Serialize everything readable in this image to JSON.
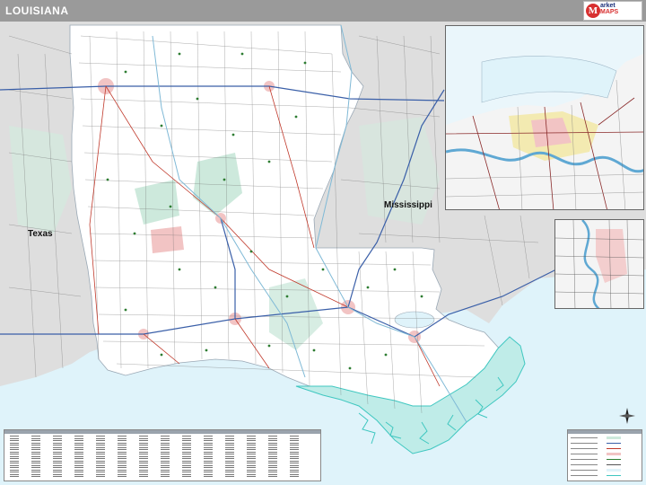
{
  "header": {
    "title": "LOUISIANA"
  },
  "map": {
    "labels": {
      "texas": "Texas",
      "mississippi": "Mississippi"
    },
    "colors": {
      "water": "#dff3fa",
      "coast_water": "#3fc7c0",
      "land_louisiana": "#ffffff",
      "land_neighbors": "#dedede",
      "urban": "#f2c4c4",
      "forest": "#cde9dc",
      "roads": "#555555",
      "interstate": "#3a5fa8",
      "highway": "#c0392b",
      "route_markers": "#2e7d32",
      "title_bar": "#9a9a9a"
    }
  },
  "logo": {
    "mark": "M",
    "line1": "arket",
    "line2": "MAPS"
  }
}
